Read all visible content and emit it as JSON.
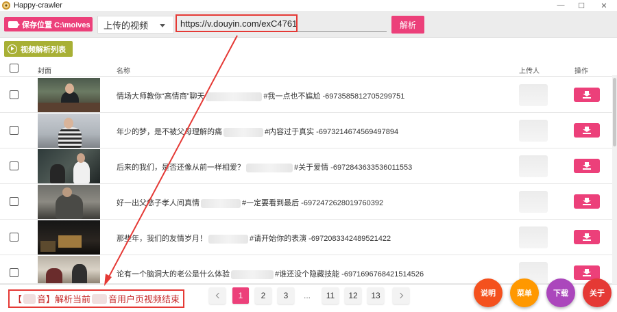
{
  "window": {
    "title": "Happy-crawler",
    "controls": [
      "—",
      "☐",
      "✕"
    ]
  },
  "toolbar": {
    "save_label": "保存位置 C:\\moives",
    "source_select": "上传的视频",
    "url_value": "https://v.douyin.com/exC4761/",
    "parse_label": "解析"
  },
  "list_button": {
    "label": "视频解析列表"
  },
  "table": {
    "columns": {
      "cover": "封面",
      "name": "名称",
      "uploader": "上传人",
      "action": "操作"
    },
    "rows": [
      {
        "title_start": "情场大师教你“高情商”聊天",
        "title_end": "#我一点也不尴尬 -6973585812705299751"
      },
      {
        "title_start": "年少的梦，是不被父母理解的痛",
        "title_end": "#内容过于真实 -6973214674569497894"
      },
      {
        "title_start": "后来的我们，是否还像从前一样相爱？",
        "title_end": "#关于爱情 -6972843633536011553"
      },
      {
        "title_start": "好一出父慈子孝人间真情",
        "title_end": "#一定要看到最后 -6972472628019760392"
      },
      {
        "title_start": "那些年，我们的友情岁月！",
        "title_end": "#请开始你的表演 -6972083342489521422"
      },
      {
        "title_start": "论有一个脑洞大的老公是什么体验",
        "title_end": "#谁还没个隐藏技能 -6971696768421514526"
      }
    ]
  },
  "status": {
    "prefix": "【",
    "middle": "音】解析当前",
    "suffix": "音用户页视频结束"
  },
  "pagination": {
    "pages": [
      "1",
      "2",
      "3",
      "11",
      "12",
      "13"
    ],
    "ellipsis": "...",
    "current": "1"
  },
  "fabs": {
    "help": "说明",
    "menu": "菜单",
    "download": "下载",
    "close": "关于"
  },
  "colors": {
    "accent": "#ec407a",
    "list_button": "#a8b035",
    "annotation": "#e53935",
    "fab_help": "#f4511e",
    "fab_menu": "#ff9800",
    "fab_download": "#ab47bc",
    "fab_close": "#e53935"
  }
}
